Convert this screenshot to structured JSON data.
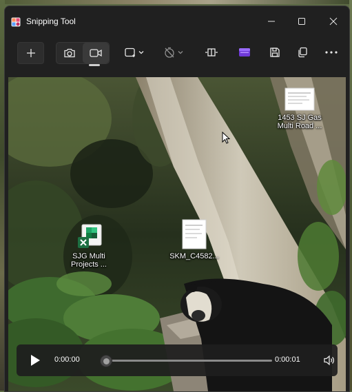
{
  "window": {
    "title": "Snipping Tool",
    "controls": {
      "minimize_icon": "minimize-icon",
      "maximize_icon": "maximize-icon",
      "close_icon": "close-icon"
    }
  },
  "toolbar": {
    "new_icon": "plus-icon",
    "modes": [
      {
        "icon": "camera-icon",
        "selected": false
      },
      {
        "icon": "video-camera-icon",
        "selected": true
      }
    ],
    "snip_shape_icon": "rectangle-snip-icon",
    "delay_icon": "timer-off-icon",
    "trim_icon": "trim-icon",
    "clipchamp_icon": "clipchamp-icon",
    "save_icon": "save-icon",
    "copy_icon": "copy-icon",
    "more_icon": "more-icon"
  },
  "desktop": {
    "icons": [
      {
        "label_line1": "1453 SJ Gas",
        "label_line2": "Multi Road ...",
        "type": "document"
      },
      {
        "label_line1": "SJG Multi",
        "label_line2": "Projects ...",
        "type": "excel"
      },
      {
        "label_line1": "SKM_C4582...",
        "label_line2": "",
        "type": "document"
      }
    ]
  },
  "player": {
    "current_time": "0:00:00",
    "total_time": "0:00:01",
    "progress": 0.0,
    "play_icon": "play-icon",
    "volume_icon": "volume-icon"
  },
  "colors": {
    "window_bg": "#202020",
    "accent_clipchamp": "#7b3fe4",
    "excel_green": "#1d6f42"
  }
}
